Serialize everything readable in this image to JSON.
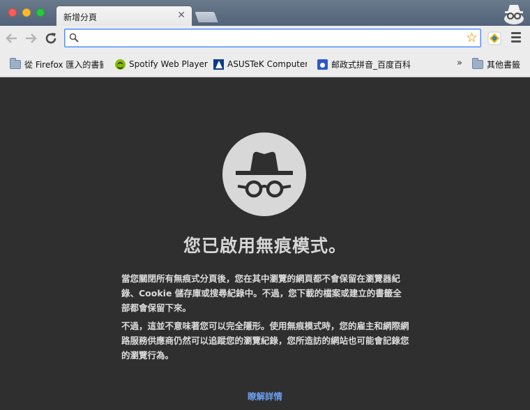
{
  "tab": {
    "title": "新增分頁",
    "close": "✕"
  },
  "toolbar": {
    "omnibox_value": "",
    "omnibox_placeholder": ""
  },
  "bookmarks": {
    "items": [
      {
        "label": "從 Firefox 匯入的書籤",
        "icon": "folder-icon"
      },
      {
        "label": "Spotify Web Player",
        "icon": "spotify-icon"
      },
      {
        "label": "ASUSTeK Computer Inc.",
        "icon": "asus-icon"
      },
      {
        "label": "邮政式拼音_百度百科",
        "icon": "baidu-icon"
      }
    ],
    "more": "»",
    "other": "其他書籤"
  },
  "incognito": {
    "headline": "您已啟用無痕模式。",
    "paragraph1": "當您關閉所有無痕式分頁後，您在其中瀏覽的網頁都不會保留在瀏覽器紀錄、Cookie 儲存庫或搜尋紀錄中。不過，您下載的檔案或建立的書籤全部都會保留下來。",
    "paragraph2": "不過，這並不意味著您可以完全隱形。使用無痕模式時，您的雇主和網際網路服務供應商仍然可以追蹤您的瀏覽紀錄，您所造訪的網站也可能會記錄您的瀏覽行為。",
    "learn_more": "瞭解詳情"
  },
  "colors": {
    "background": "#2f2f2f",
    "link": "#6b9ef0",
    "icon_circle": "#d8d8d8"
  }
}
